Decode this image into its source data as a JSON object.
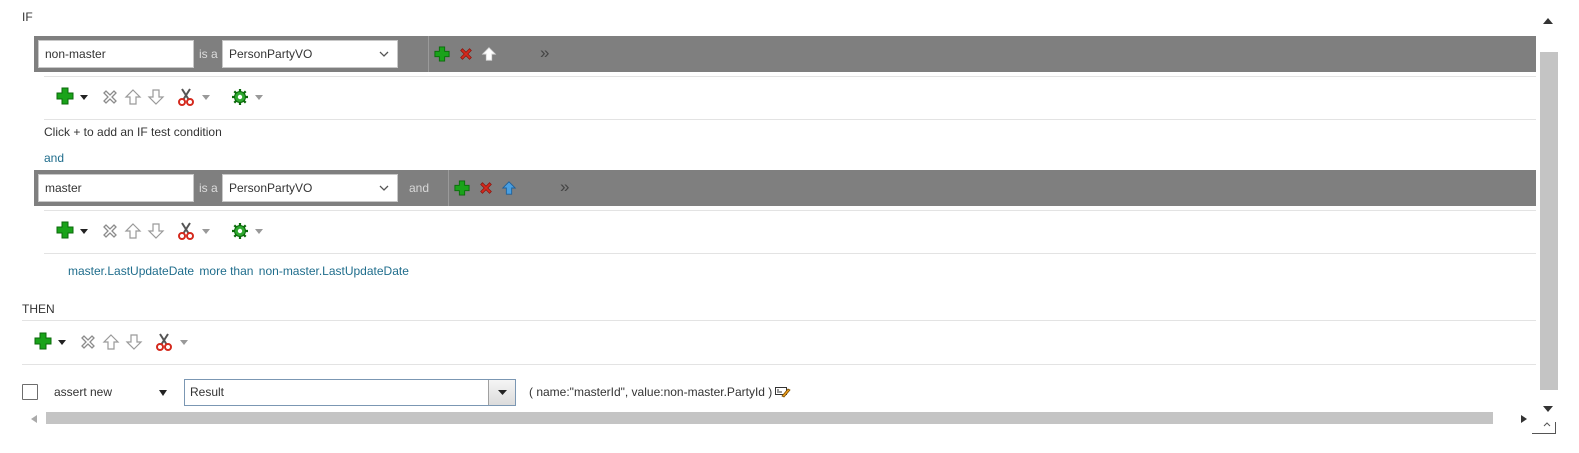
{
  "if_section": {
    "label": "IF"
  },
  "pattern1": {
    "variable": "non-master",
    "is_a": "is a",
    "type": "PersonPartyVO",
    "hint": "Click + to add an IF test condition"
  },
  "connector": "and",
  "pattern2": {
    "variable": "master",
    "is_a": "is a",
    "type": "PersonPartyVO",
    "and_label": "and",
    "condition": {
      "left": "master.LastUpdateDate",
      "operator": "more than",
      "right": "non-master.LastUpdateDate"
    }
  },
  "then_section": {
    "label": "THEN",
    "action": "assert new",
    "fact_type": "Result",
    "arguments": "( name:\"masterId\", value:non-master.PartyId )"
  },
  "icons": {
    "add": "add-icon",
    "delete": "delete-icon",
    "move_up": "move-up-icon",
    "move_down": "move-down-icon",
    "cut": "cut-icon",
    "settings": "gear-icon",
    "expand": "expand-icon",
    "edit": "edit-properties-icon"
  },
  "colors": {
    "bar": "#7f7f7f",
    "add_green": "#1aa31a",
    "delete_red": "#d42a1e",
    "link": "#1f6d8c",
    "up_blue": "#4a9fe0"
  }
}
